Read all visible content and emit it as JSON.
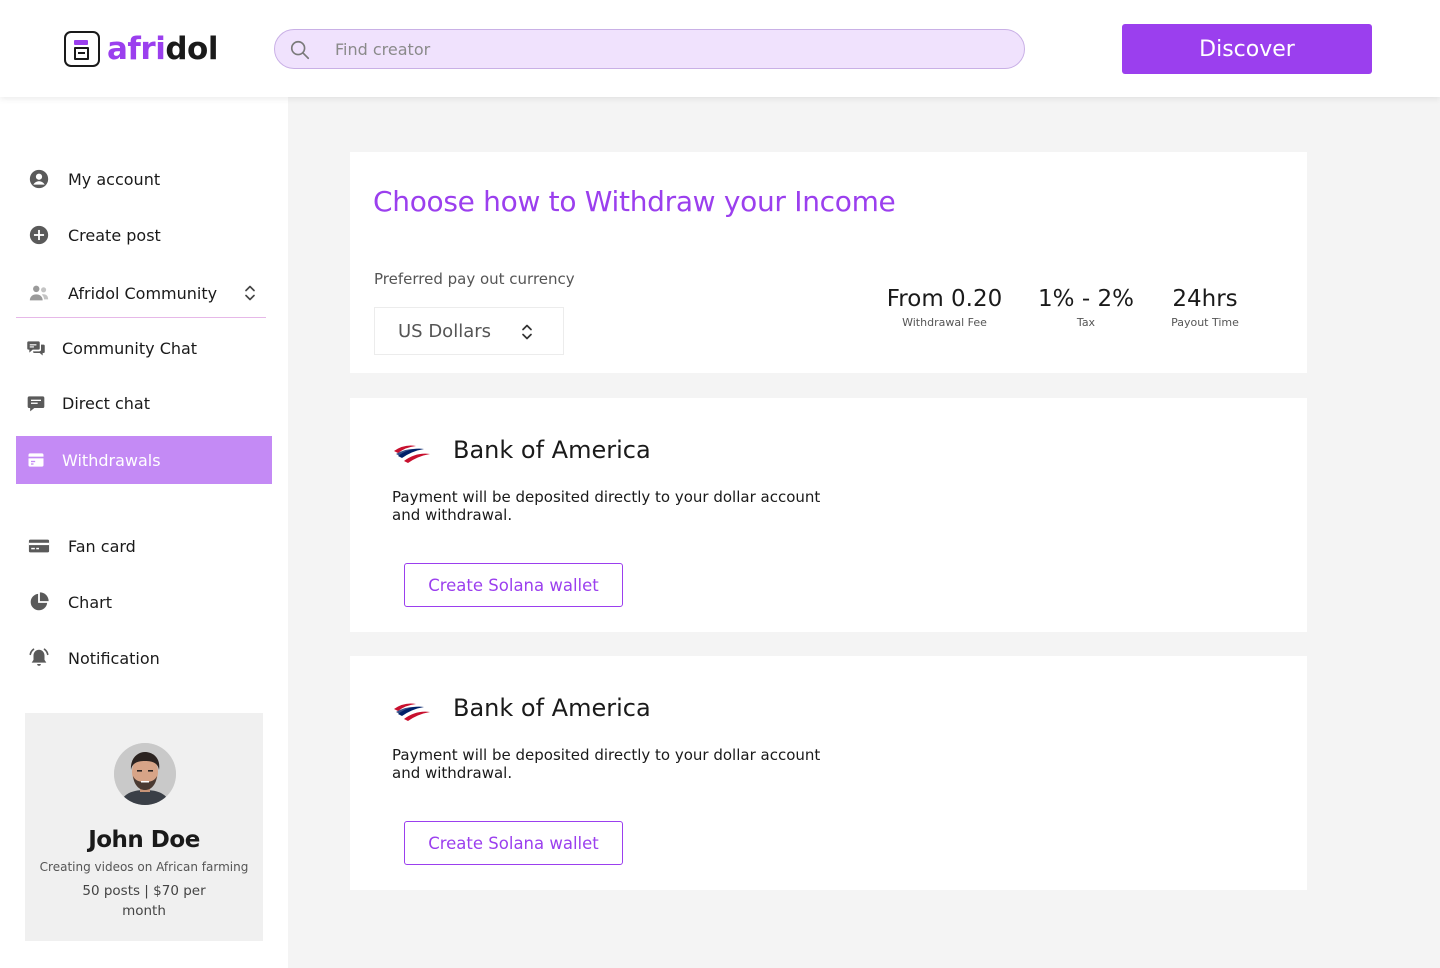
{
  "header": {
    "logo_part1": "afri",
    "logo_part2": "dol",
    "search_placeholder": "Find creator",
    "discover_label": "Discover"
  },
  "sidebar": {
    "items": [
      {
        "label": "My account",
        "icon": "user-circle-icon"
      },
      {
        "label": "Create post",
        "icon": "plus-circle-icon"
      },
      {
        "label": "Afridol Community",
        "icon": "people-icon"
      },
      {
        "label": "Community Chat",
        "icon": "chat-bubbles-icon"
      },
      {
        "label": "Direct chat",
        "icon": "chat-bubble-icon"
      },
      {
        "label": "Withdrawals",
        "icon": "wallet-icon",
        "active": true
      },
      {
        "label": "Fan card",
        "icon": "card-icon"
      },
      {
        "label": "Chart",
        "icon": "pie-chart-icon"
      },
      {
        "label": "Notification",
        "icon": "bell-icon"
      }
    ]
  },
  "profile": {
    "name": "John Doe",
    "description": "Creating videos on African farming",
    "stats": "50 posts | $70 per month"
  },
  "withdraw": {
    "title": "Choose how to Withdraw your Income",
    "currency_label": "Preferred pay out currency",
    "currency_value": "US Dollars",
    "stats": [
      {
        "value": "From 0.20",
        "label": "Withdrawal Fee"
      },
      {
        "value": "1% - 2%",
        "label": "Tax"
      },
      {
        "value": "24hrs",
        "label": "Payout Time"
      }
    ]
  },
  "banks": [
    {
      "name": "Bank of America",
      "description": "Payment will be deposited directly to your dollar account and withdrawal.",
      "button_label": "Create Solana wallet"
    },
    {
      "name": "Bank of America",
      "description": "Payment will be deposited directly to your dollar account and withdrawal.",
      "button_label": "Create Solana wallet"
    }
  ],
  "colors": {
    "accent": "#9b3fee",
    "active_nav": "#c48af5",
    "search_bg": "#f0e2fd"
  }
}
